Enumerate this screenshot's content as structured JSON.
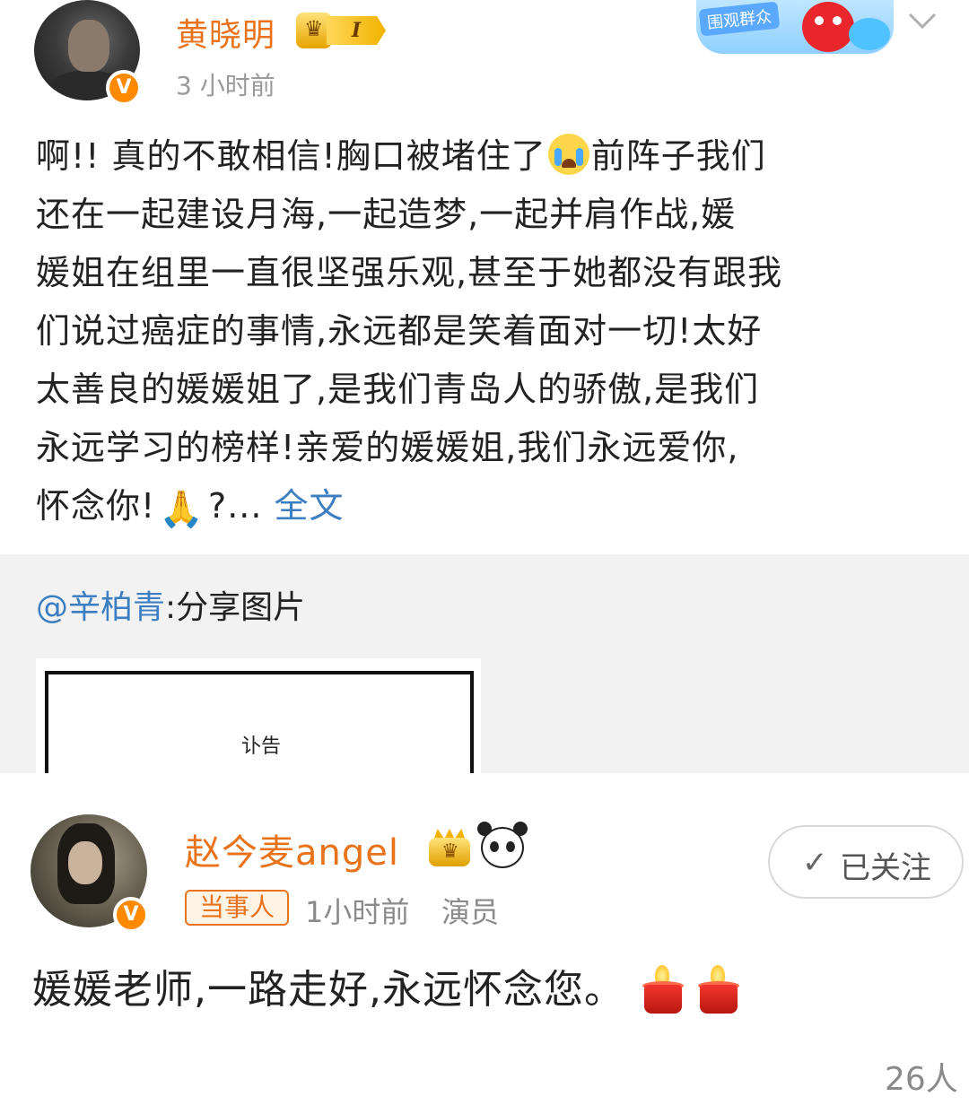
{
  "post1": {
    "author": "黄晓明",
    "level_badge": "I",
    "time": "3 小时前",
    "body_lines": [
      "啊!! 真的不敢相信!胸口被堵住了",
      "前阵子我们",
      "还在一起建设月海,一起造梦,一起并肩作战,媛",
      "媛姐在组里一直很坚强乐观,甚至于她都没有跟我",
      "们说过癌症的事情,永远都是笑着面对一切!太好",
      "太善良的媛媛姐了,是我们青岛人的骄傲,是我们",
      "永远学习的榜样!亲爱的媛媛姐,我们永远爱你,",
      "怀念你!",
      "?...",
      "全文"
    ],
    "decor_tag": "围观群众",
    "repost": {
      "mention": "@辛柏青",
      "text": ":分享图片",
      "notice_title": "讣告"
    }
  },
  "post2": {
    "author": "赵今麦angel",
    "role_tag": "当事人",
    "time": "1小时前",
    "occupation": "演员",
    "follow_label": "已关注",
    "body": "媛媛老师,一路走好,永远怀念您。"
  },
  "reading_count": "26人",
  "icons": {
    "verified": "verified-v-icon",
    "crown": "crown-icon",
    "panda": "panda-icon",
    "candle": "candle-icon",
    "pray": "pray-emoji",
    "cry": "crying-emoji",
    "chevron": "chevron-down-icon",
    "check": "check-icon"
  },
  "colors": {
    "name": "#e8731a",
    "link": "#3b7ec2",
    "verified": "#ff8a00",
    "muted": "#9a9a9a",
    "repost_bg": "#f2f2f2"
  }
}
